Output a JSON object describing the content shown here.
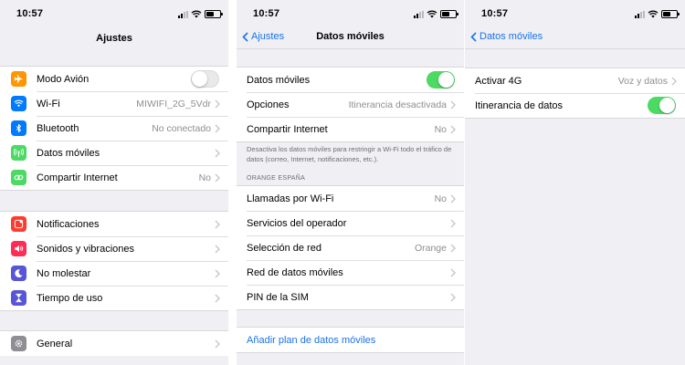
{
  "colors": {
    "ios_blue": "#1a73e8",
    "toggle_on": "#4cd964",
    "secondary_text": "#8e8e93",
    "group_bg": "#efeff4"
  },
  "screens": [
    {
      "status_time": "10:57",
      "nav_title": "Ajustes",
      "groups": [
        {
          "items": [
            {
              "label": "Modo Avión",
              "icon": "airplane-icon",
              "icon_color": "#ff9500",
              "control": "toggle-off"
            },
            {
              "label": "Wi-Fi",
              "value": "MIWIFI_2G_5Vdr",
              "icon": "wifi-icon",
              "icon_color": "#007aff"
            },
            {
              "label": "Bluetooth",
              "value": "No conectado",
              "icon": "bluetooth-icon",
              "icon_color": "#007aff"
            },
            {
              "label": "Datos móviles",
              "icon": "antenna-icon",
              "icon_color": "#4cd964"
            },
            {
              "label": "Compartir Internet",
              "value": "No",
              "icon": "chain-icon",
              "icon_color": "#4cd964"
            }
          ]
        },
        {
          "items": [
            {
              "label": "Notificaciones",
              "icon": "notifications-icon",
              "icon_color": "#ff3b30"
            },
            {
              "label": "Sonidos y vibraciones",
              "icon": "speaker-icon",
              "icon_color": "#ff2d55"
            },
            {
              "label": "No molestar",
              "icon": "moon-icon",
              "icon_color": "#5856d6"
            },
            {
              "label": "Tiempo de uso",
              "icon": "hourglass-icon",
              "icon_color": "#5856d6"
            }
          ]
        },
        {
          "items": [
            {
              "label": "General",
              "icon": "gear-icon",
              "icon_color": "#8e8e93"
            }
          ]
        }
      ]
    },
    {
      "status_time": "10:57",
      "nav_title": "Datos móviles",
      "back_label": "Ajustes",
      "groups": [
        {
          "items": [
            {
              "label": "Datos móviles",
              "control": "toggle-on"
            },
            {
              "label": "Opciones",
              "value": "Itinerancia desactivada"
            },
            {
              "label": "Compartir Internet",
              "value": "No"
            }
          ]
        }
      ],
      "note": "Desactiva los datos móviles para restringir a Wi-Fi todo el tráfico de datos (correo, Internet, notificaciones, etc.).",
      "section_header": "ORANGE ESPAÑA",
      "carrier_group": {
        "items": [
          {
            "label": "Llamadas por Wi-Fi",
            "value": "No"
          },
          {
            "label": "Servicios del operador"
          },
          {
            "label": "Selección de red",
            "value": "Orange"
          },
          {
            "label": "Red de datos móviles"
          },
          {
            "label": "PIN de la SIM"
          }
        ]
      },
      "add_plan_label": "Añadir plan de datos móviles"
    },
    {
      "status_time": "10:57",
      "back_label": "Datos móviles",
      "groups": [
        {
          "items": [
            {
              "label": "Activar 4G",
              "value": "Voz y datos"
            },
            {
              "label": "Itinerancia de datos",
              "control": "toggle-on"
            }
          ]
        }
      ]
    }
  ]
}
